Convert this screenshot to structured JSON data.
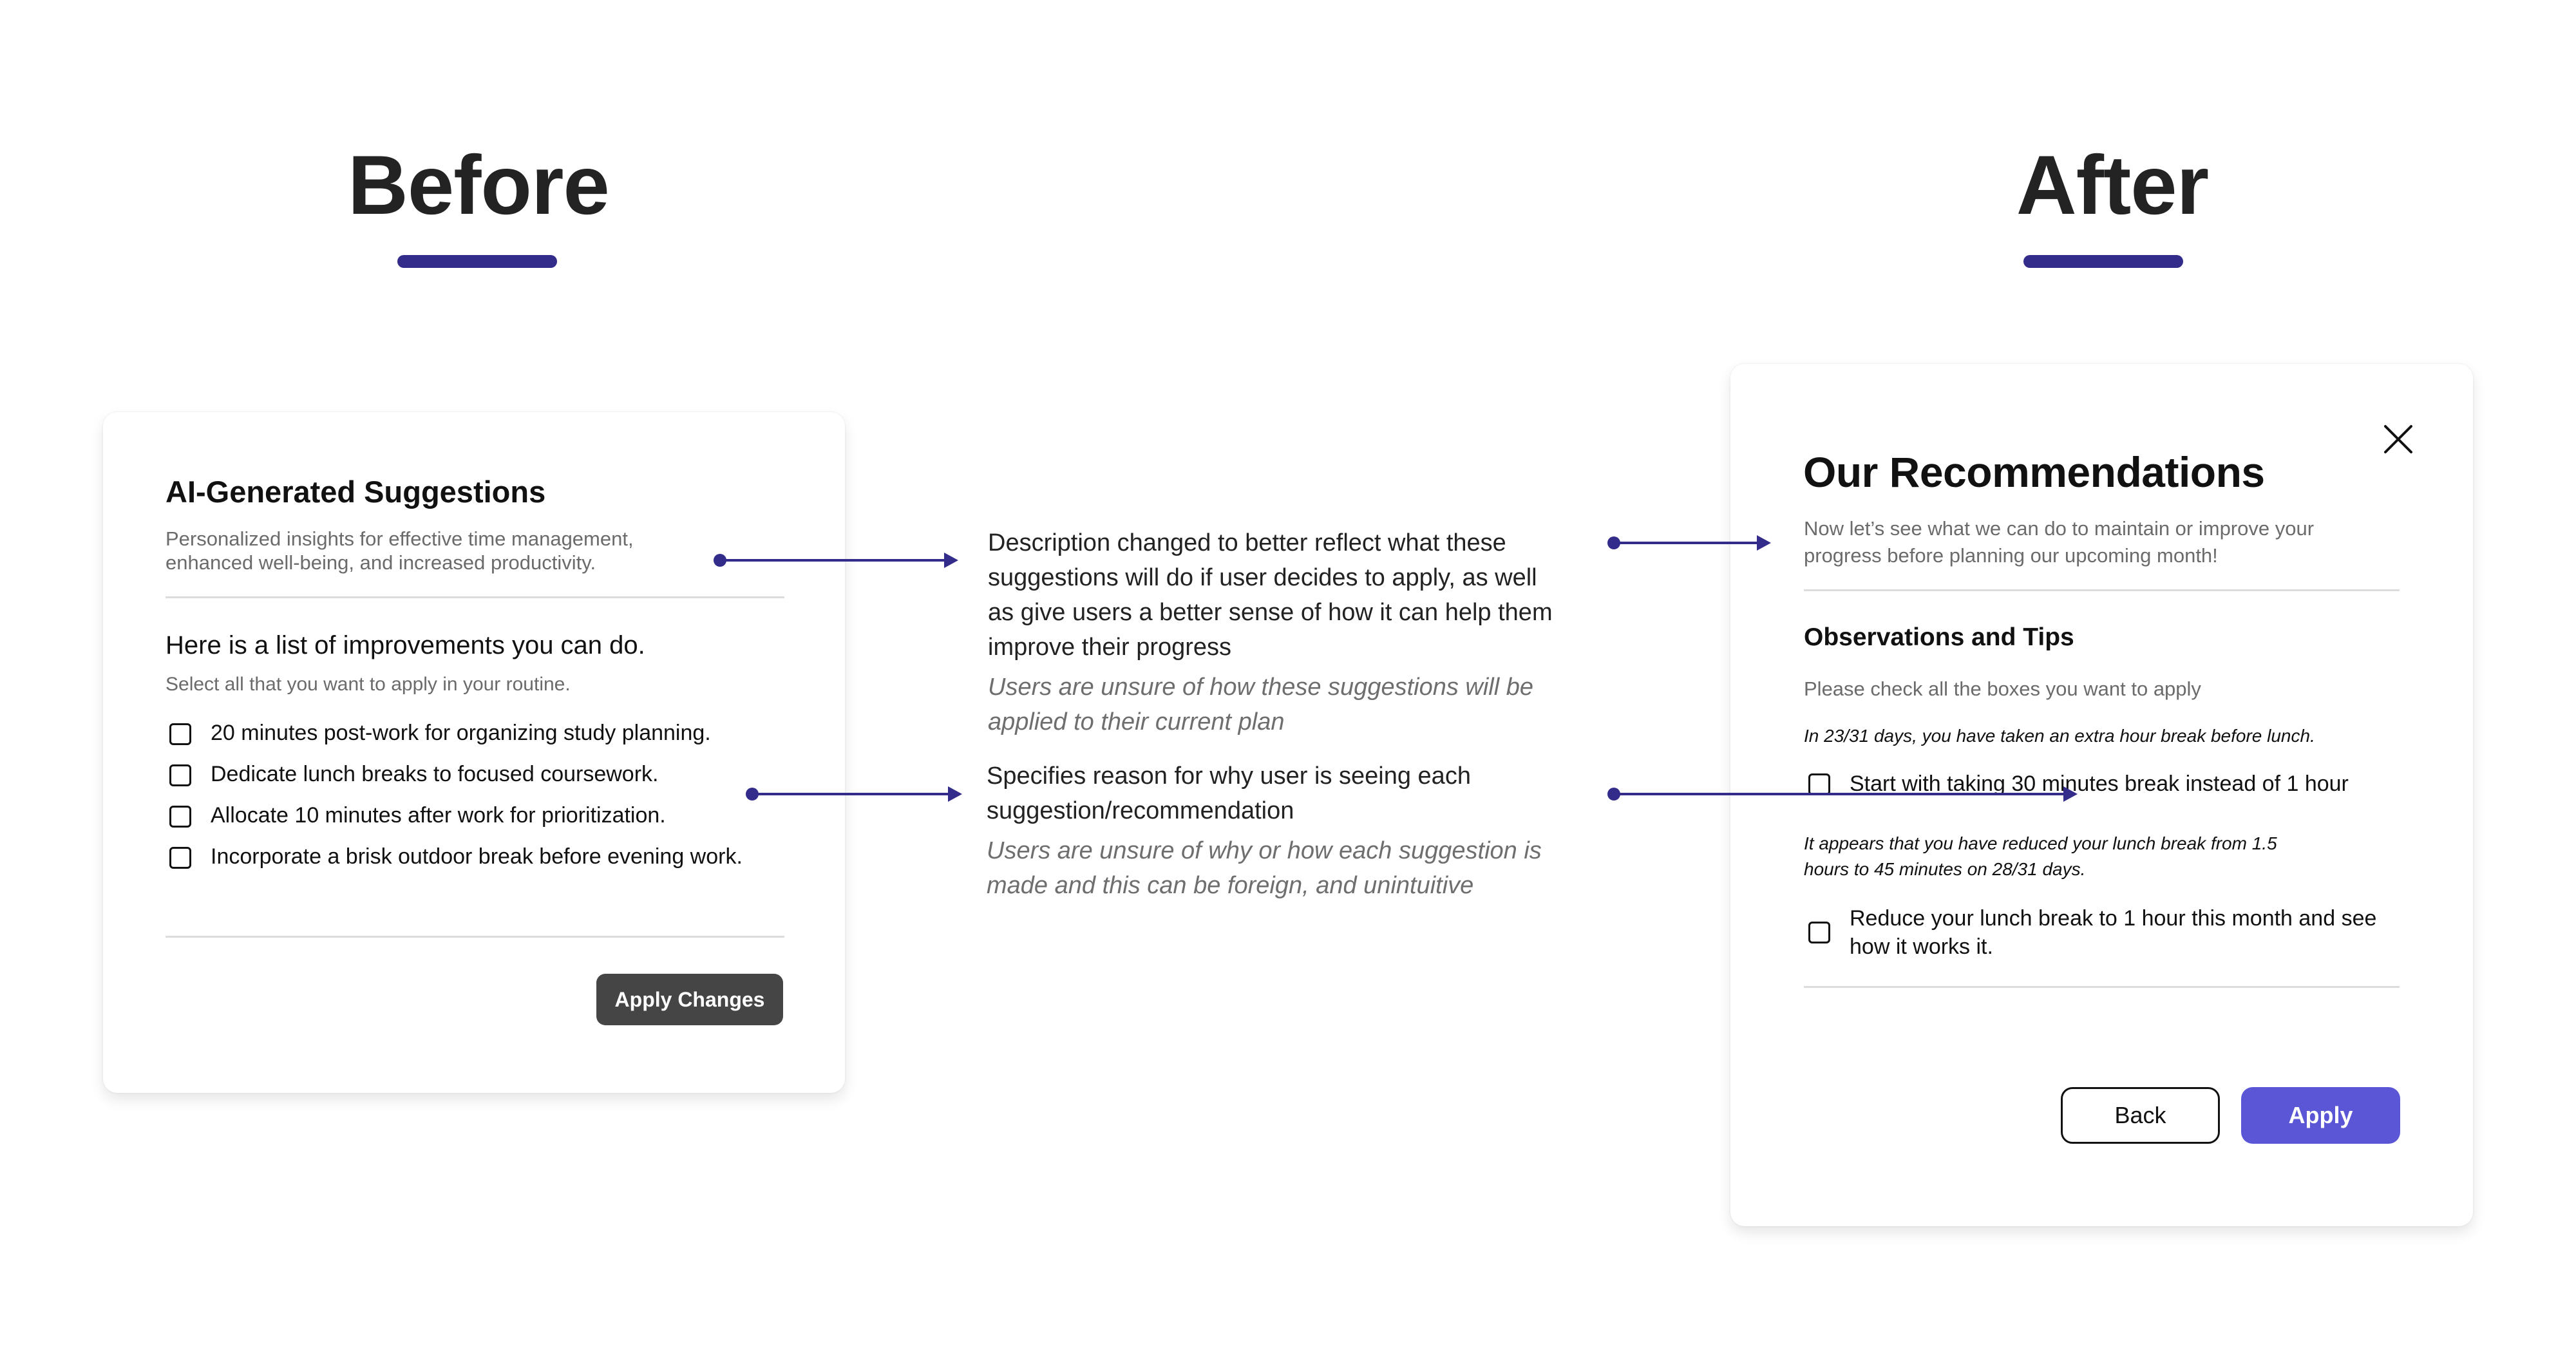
{
  "colors": {
    "accent_bar": "#332C8A",
    "arrow": "#332C8A",
    "primary_button": "#5A56D6",
    "dark_button": "#454545"
  },
  "headings": {
    "before": "Before",
    "after": "After"
  },
  "before_card": {
    "title": "AI-Generated Suggestions",
    "subtitle_line1": "Personalized insights for effective time management,",
    "subtitle_line2": "enhanced well-being, and increased productivity.",
    "section_title": "Here is a list of improvements you can do.",
    "section_hint": "Select all that you want to apply in your routine.",
    "items": [
      {
        "label": "20 minutes post-work for organizing study planning.",
        "checked": false
      },
      {
        "label": "Dedicate lunch breaks to focused coursework.",
        "checked": false
      },
      {
        "label": "Allocate 10 minutes after work for prioritization.",
        "checked": false
      },
      {
        "label": "Incorporate a brisk outdoor break before evening work.",
        "checked": false
      }
    ],
    "apply_button": "Apply Changes"
  },
  "annotations": [
    {
      "change": "Description changed to better reflect what these suggestions will do if user decides to apply, as well as give users a better sense of how it can help them improve their progress",
      "change_lines": [
        "Description changed to better reflect what these",
        "suggestions will do if user decides to apply, as well",
        "as give users a better sense of how it can help them",
        "improve their progress"
      ],
      "problem_lines": [
        "Users are unsure of how these suggestions will be",
        "applied to their current plan"
      ]
    },
    {
      "change_lines": [
        "Specifies reason for why user is seeing each",
        "suggestion/recommendation"
      ],
      "problem_lines": [
        "Users are unsure of why or how each suggestion is",
        "made and this can be foreign, and unintuitive"
      ]
    }
  ],
  "after_card": {
    "title": "Our Recommendations",
    "close_icon": "close-icon",
    "subtitle_line1": "Now let’s see what we can do to maintain or improve your",
    "subtitle_line2": "progress before planning our upcoming month!",
    "section_title": "Observations and Tips",
    "section_hint": "Please check all the boxes you want to apply",
    "groups": [
      {
        "observation_lines": [
          "In 23/31 days, you have taken an extra hour break before lunch."
        ],
        "recommendation_lines": [
          "Start with taking 30 minutes break instead of 1 hour"
        ],
        "checked": false
      },
      {
        "observation_lines": [
          "It appears that you have reduced your lunch break from 1.5",
          "hours to 45 minutes on 28/31 days."
        ],
        "recommendation_lines": [
          "Reduce your lunch break to 1 hour this month and see",
          "how it works it."
        ],
        "checked": false
      }
    ],
    "back_button": "Back",
    "apply_button": "Apply"
  }
}
